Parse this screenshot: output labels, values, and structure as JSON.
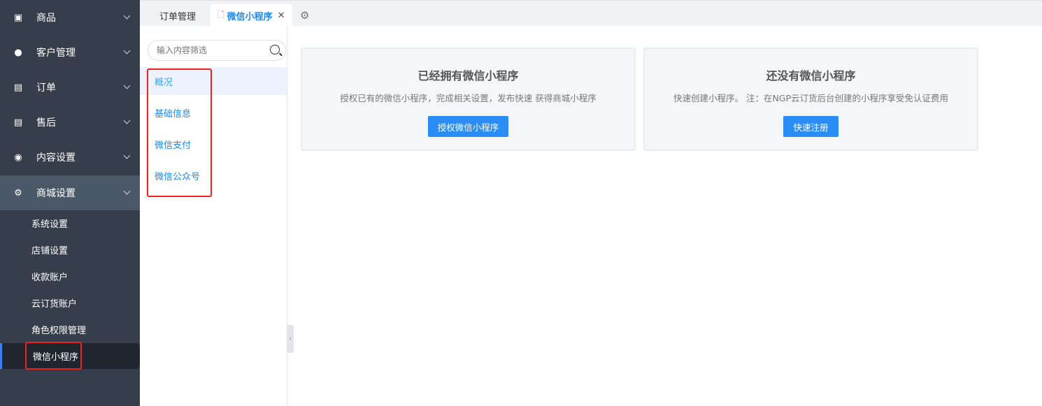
{
  "sidebar": {
    "groups": [
      {
        "label": "商品",
        "icon": "product-icon"
      },
      {
        "label": "客户管理",
        "icon": "customer-icon"
      },
      {
        "label": "订单",
        "icon": "order-icon"
      },
      {
        "label": "售后",
        "icon": "after-sale-icon"
      },
      {
        "label": "内容设置",
        "icon": "eye-icon"
      },
      {
        "label": "商城设置",
        "icon": "gear-icon"
      }
    ],
    "sub_items": [
      "系统设置",
      "店铺设置",
      "收款账户",
      "云订货账户",
      "角色权限管理",
      "微信小程序"
    ]
  },
  "tabs": [
    {
      "label": "订单管理"
    },
    {
      "label": "微信小程序"
    }
  ],
  "search": {
    "placeholder": "输入内容筛选"
  },
  "menu": [
    "概况",
    "基础信息",
    "微信支付",
    "微信公众号"
  ],
  "cards": [
    {
      "title": "已经拥有微信小程序",
      "desc": "授权已有的微信小程序，完成相关设置，发布快速 获得商城小程序",
      "button": "授权微信小程序"
    },
    {
      "title": "还没有微信小程序",
      "desc": "快速创建小程序。 注：在NGP云订货后台创建的小程序享受免认证费用",
      "button": "快速注册"
    }
  ],
  "colors": {
    "sidebar": "#363d4b",
    "accent": "#2a8cf5",
    "highlight": "#f0231c"
  }
}
